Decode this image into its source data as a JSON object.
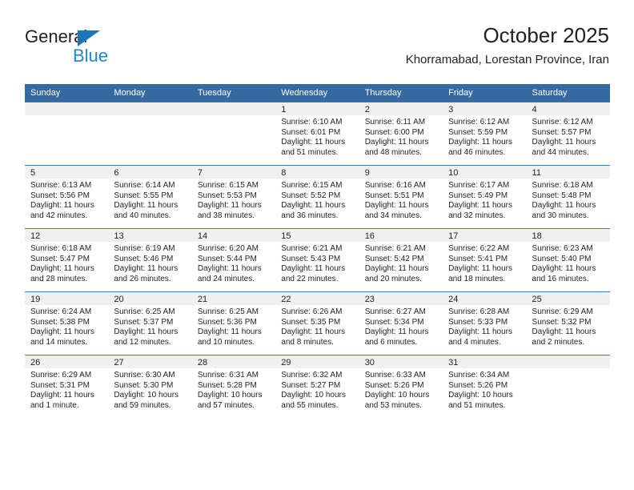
{
  "brand": {
    "name_part1": "General",
    "name_part2": "Blue",
    "triangle_color": "#1b75bb",
    "blue_text_color": "#2087d4"
  },
  "header": {
    "title": "October 2025",
    "subtitle": "Khorramabad, Lorestan Province, Iran",
    "header_bg_color": "#36699f",
    "header_text_color": "#ffffff",
    "daynum_strip_color": "#f0f0f0",
    "row_divider_color": "#3b7cb5"
  },
  "weekday_headers": [
    "Sunday",
    "Monday",
    "Tuesday",
    "Wednesday",
    "Thursday",
    "Friday",
    "Saturday"
  ],
  "labels": {
    "sunrise_prefix": "Sunrise:",
    "sunset_prefix": "Sunset:",
    "daylight_prefix": "Daylight:"
  },
  "weeks": [
    [
      {
        "empty": true
      },
      {
        "empty": true
      },
      {
        "empty": true
      },
      {
        "day": "1",
        "sunrise": "Sunrise: 6:10 AM",
        "sunset": "Sunset: 6:01 PM",
        "daylight1": "Daylight: 11 hours",
        "daylight2": "and 51 minutes."
      },
      {
        "day": "2",
        "sunrise": "Sunrise: 6:11 AM",
        "sunset": "Sunset: 6:00 PM",
        "daylight1": "Daylight: 11 hours",
        "daylight2": "and 48 minutes."
      },
      {
        "day": "3",
        "sunrise": "Sunrise: 6:12 AM",
        "sunset": "Sunset: 5:59 PM",
        "daylight1": "Daylight: 11 hours",
        "daylight2": "and 46 minutes."
      },
      {
        "day": "4",
        "sunrise": "Sunrise: 6:12 AM",
        "sunset": "Sunset: 5:57 PM",
        "daylight1": "Daylight: 11 hours",
        "daylight2": "and 44 minutes."
      }
    ],
    [
      {
        "day": "5",
        "sunrise": "Sunrise: 6:13 AM",
        "sunset": "Sunset: 5:56 PM",
        "daylight1": "Daylight: 11 hours",
        "daylight2": "and 42 minutes."
      },
      {
        "day": "6",
        "sunrise": "Sunrise: 6:14 AM",
        "sunset": "Sunset: 5:55 PM",
        "daylight1": "Daylight: 11 hours",
        "daylight2": "and 40 minutes."
      },
      {
        "day": "7",
        "sunrise": "Sunrise: 6:15 AM",
        "sunset": "Sunset: 5:53 PM",
        "daylight1": "Daylight: 11 hours",
        "daylight2": "and 38 minutes."
      },
      {
        "day": "8",
        "sunrise": "Sunrise: 6:15 AM",
        "sunset": "Sunset: 5:52 PM",
        "daylight1": "Daylight: 11 hours",
        "daylight2": "and 36 minutes."
      },
      {
        "day": "9",
        "sunrise": "Sunrise: 6:16 AM",
        "sunset": "Sunset: 5:51 PM",
        "daylight1": "Daylight: 11 hours",
        "daylight2": "and 34 minutes."
      },
      {
        "day": "10",
        "sunrise": "Sunrise: 6:17 AM",
        "sunset": "Sunset: 5:49 PM",
        "daylight1": "Daylight: 11 hours",
        "daylight2": "and 32 minutes."
      },
      {
        "day": "11",
        "sunrise": "Sunrise: 6:18 AM",
        "sunset": "Sunset: 5:48 PM",
        "daylight1": "Daylight: 11 hours",
        "daylight2": "and 30 minutes."
      }
    ],
    [
      {
        "day": "12",
        "sunrise": "Sunrise: 6:18 AM",
        "sunset": "Sunset: 5:47 PM",
        "daylight1": "Daylight: 11 hours",
        "daylight2": "and 28 minutes."
      },
      {
        "day": "13",
        "sunrise": "Sunrise: 6:19 AM",
        "sunset": "Sunset: 5:46 PM",
        "daylight1": "Daylight: 11 hours",
        "daylight2": "and 26 minutes."
      },
      {
        "day": "14",
        "sunrise": "Sunrise: 6:20 AM",
        "sunset": "Sunset: 5:44 PM",
        "daylight1": "Daylight: 11 hours",
        "daylight2": "and 24 minutes."
      },
      {
        "day": "15",
        "sunrise": "Sunrise: 6:21 AM",
        "sunset": "Sunset: 5:43 PM",
        "daylight1": "Daylight: 11 hours",
        "daylight2": "and 22 minutes."
      },
      {
        "day": "16",
        "sunrise": "Sunrise: 6:21 AM",
        "sunset": "Sunset: 5:42 PM",
        "daylight1": "Daylight: 11 hours",
        "daylight2": "and 20 minutes."
      },
      {
        "day": "17",
        "sunrise": "Sunrise: 6:22 AM",
        "sunset": "Sunset: 5:41 PM",
        "daylight1": "Daylight: 11 hours",
        "daylight2": "and 18 minutes."
      },
      {
        "day": "18",
        "sunrise": "Sunrise: 6:23 AM",
        "sunset": "Sunset: 5:40 PM",
        "daylight1": "Daylight: 11 hours",
        "daylight2": "and 16 minutes."
      }
    ],
    [
      {
        "day": "19",
        "sunrise": "Sunrise: 6:24 AM",
        "sunset": "Sunset: 5:38 PM",
        "daylight1": "Daylight: 11 hours",
        "daylight2": "and 14 minutes."
      },
      {
        "day": "20",
        "sunrise": "Sunrise: 6:25 AM",
        "sunset": "Sunset: 5:37 PM",
        "daylight1": "Daylight: 11 hours",
        "daylight2": "and 12 minutes."
      },
      {
        "day": "21",
        "sunrise": "Sunrise: 6:25 AM",
        "sunset": "Sunset: 5:36 PM",
        "daylight1": "Daylight: 11 hours",
        "daylight2": "and 10 minutes."
      },
      {
        "day": "22",
        "sunrise": "Sunrise: 6:26 AM",
        "sunset": "Sunset: 5:35 PM",
        "daylight1": "Daylight: 11 hours",
        "daylight2": "and 8 minutes."
      },
      {
        "day": "23",
        "sunrise": "Sunrise: 6:27 AM",
        "sunset": "Sunset: 5:34 PM",
        "daylight1": "Daylight: 11 hours",
        "daylight2": "and 6 minutes."
      },
      {
        "day": "24",
        "sunrise": "Sunrise: 6:28 AM",
        "sunset": "Sunset: 5:33 PM",
        "daylight1": "Daylight: 11 hours",
        "daylight2": "and 4 minutes."
      },
      {
        "day": "25",
        "sunrise": "Sunrise: 6:29 AM",
        "sunset": "Sunset: 5:32 PM",
        "daylight1": "Daylight: 11 hours",
        "daylight2": "and 2 minutes."
      }
    ],
    [
      {
        "day": "26",
        "sunrise": "Sunrise: 6:29 AM",
        "sunset": "Sunset: 5:31 PM",
        "daylight1": "Daylight: 11 hours",
        "daylight2": "and 1 minute."
      },
      {
        "day": "27",
        "sunrise": "Sunrise: 6:30 AM",
        "sunset": "Sunset: 5:30 PM",
        "daylight1": "Daylight: 10 hours",
        "daylight2": "and 59 minutes."
      },
      {
        "day": "28",
        "sunrise": "Sunrise: 6:31 AM",
        "sunset": "Sunset: 5:28 PM",
        "daylight1": "Daylight: 10 hours",
        "daylight2": "and 57 minutes."
      },
      {
        "day": "29",
        "sunrise": "Sunrise: 6:32 AM",
        "sunset": "Sunset: 5:27 PM",
        "daylight1": "Daylight: 10 hours",
        "daylight2": "and 55 minutes."
      },
      {
        "day": "30",
        "sunrise": "Sunrise: 6:33 AM",
        "sunset": "Sunset: 5:26 PM",
        "daylight1": "Daylight: 10 hours",
        "daylight2": "and 53 minutes."
      },
      {
        "day": "31",
        "sunrise": "Sunrise: 6:34 AM",
        "sunset": "Sunset: 5:26 PM",
        "daylight1": "Daylight: 10 hours",
        "daylight2": "and 51 minutes."
      },
      {
        "empty": true
      }
    ]
  ]
}
